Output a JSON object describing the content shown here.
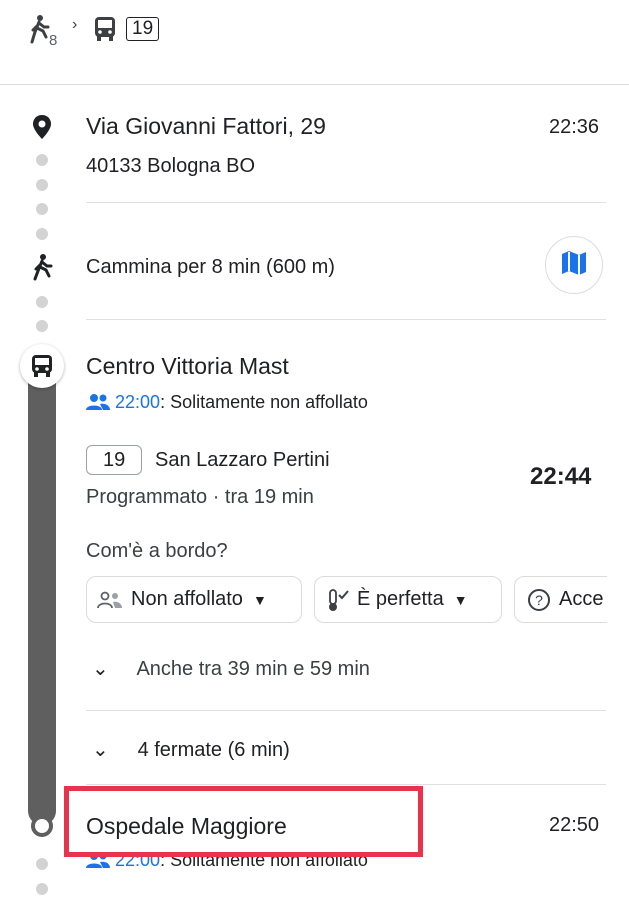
{
  "header": {
    "walk_minutes": "8",
    "route": "19"
  },
  "origin": {
    "name": "Via Giovanni Fattori, 29",
    "address": "40133 Bologna BO",
    "time": "22:36"
  },
  "walk": {
    "label": "Cammina per 8 min (600 m)"
  },
  "board_stop": {
    "name": "Centro Vittoria Mast",
    "crowd_time": "22:00",
    "crowd_text": ": Solitamente non affollato",
    "route": "19",
    "destination": "San Lazzaro Pertini",
    "departure": "22:44",
    "status": "Programmato · tra 19 min",
    "onboard_question": "Com'è a bordo?",
    "chips": [
      "Non affollato",
      "È perfetta",
      "Acce"
    ],
    "also": "Anche tra 39 min e 59 min",
    "stops": "4 fermate (6 min)"
  },
  "alight_stop": {
    "name": "Ospedale Maggiore",
    "time": "22:50",
    "crowd_time": "22:00",
    "crowd_text": ": Solitamente non affollato"
  },
  "colors": {
    "accent": "#1a73e8",
    "highlight": "#e8334a",
    "line": "#5f5f5f"
  }
}
